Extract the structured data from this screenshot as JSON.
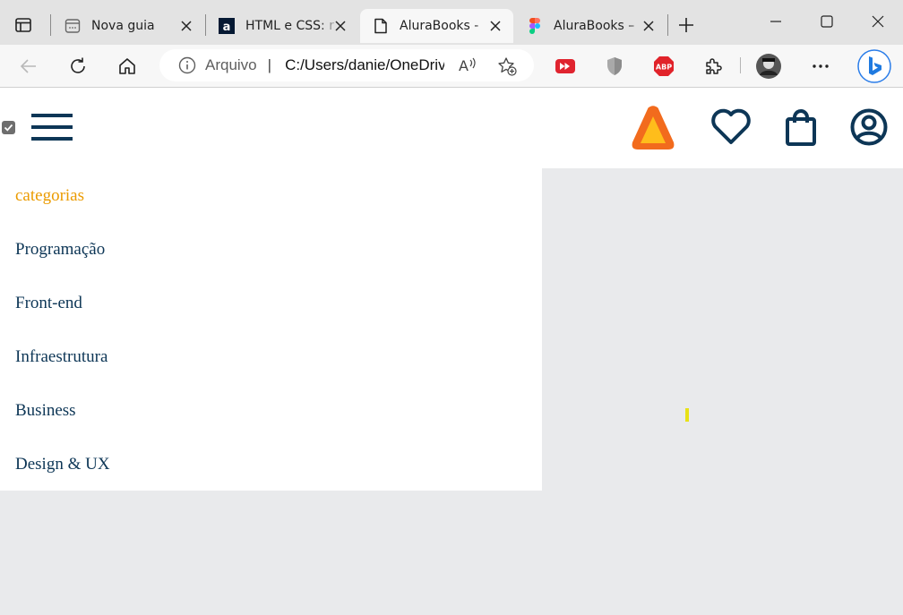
{
  "browser": {
    "tabs": [
      {
        "title": "Nova guia",
        "favicon": "new-tab-icon",
        "active": false
      },
      {
        "title": "HTML e CSS: r",
        "favicon": "alura-a-icon",
        "active": false
      },
      {
        "title": "AluraBooks - ",
        "favicon": "document-icon",
        "active": true
      },
      {
        "title": "AluraBooks – ",
        "favicon": "figma-icon",
        "active": false
      }
    ],
    "address": {
      "scheme_label": "Arquivo",
      "divider": "|",
      "url": "C:/Users/danie/OneDrive/"
    }
  },
  "page": {
    "menu": {
      "heading": "categorias",
      "items": [
        "Programação",
        "Front-end",
        "Infraestrutura",
        "Business",
        "Design & UX"
      ]
    }
  },
  "colors": {
    "brand_navy": "#0d3656",
    "accent_orange": "#eb9b00",
    "logo_orange": "#f26b1d",
    "logo_yellow": "#ffbd1b",
    "page_background": "#e9eaec"
  }
}
